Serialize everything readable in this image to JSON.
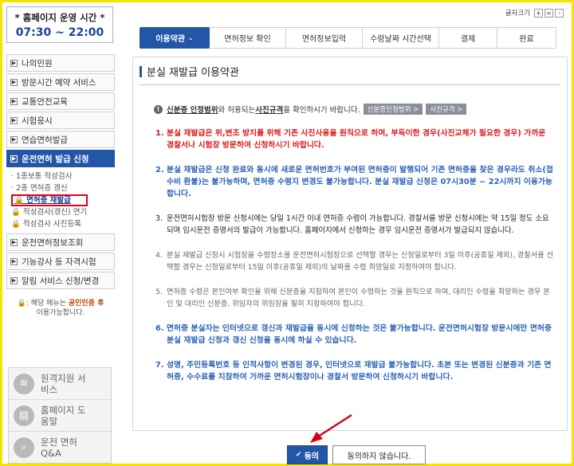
{
  "sidebar": {
    "hours_title": "* 홈페이지 운영 시간 *",
    "hours_time": "07:30 ~ 22:00",
    "menu": [
      {
        "label": "나의민원"
      },
      {
        "label": "방문시간 예약 서비스"
      },
      {
        "label": "교통안전교육"
      },
      {
        "label": "시험응시"
      },
      {
        "label": "연습면허발급"
      },
      {
        "label": "운전면허 발급 신청",
        "active": true
      }
    ],
    "submenu": [
      "1종보통 적성검사",
      "2종 면허증 갱신",
      "면허증 재발급",
      "적성검사(갱신) 연기",
      "적성검사 사진등록"
    ],
    "menu_after": [
      {
        "label": "운전면허정보조회"
      },
      {
        "label": "기능강사 등 자격시험"
      },
      {
        "label": "알림 서비스 신청/변경"
      }
    ],
    "note_prefix": ": 해당 메뉴는 ",
    "note_highlight": "공인인증 후",
    "note_suffix": "이용가능합니다.",
    "services": [
      {
        "icon": "wifi-icon",
        "label": "원격지원 서비스"
      },
      {
        "icon": "help-book-icon",
        "label": "홈페이지 도움말"
      },
      {
        "icon": "search-icon",
        "label": "운전 면허 Q&A"
      }
    ]
  },
  "font_tools": {
    "label": "글자크기",
    "plus": "+",
    "equal": "=",
    "minus": "-"
  },
  "steps": [
    {
      "label": "이용약관",
      "active": true
    },
    {
      "label": "면허정보 확인"
    },
    {
      "label": "면허정보입력"
    },
    {
      "label": "수령날짜 시간선택"
    },
    {
      "label": "결제"
    },
    {
      "label": "완료"
    }
  ],
  "content": {
    "title": "분실 재발급 이용약관",
    "info_prefix": "신분증 인정범위",
    "info_mid1": "와 허용되는 ",
    "info_bold2": "사진규격",
    "info_suffix": "을 확인하시기 바랍니다.",
    "tag1": "신분증인정범위 >",
    "tag2": "사진규격 >",
    "terms": [
      {
        "num": "1.",
        "style": "red",
        "text": "분실 재발급은 위,변조 방지를 위해 기존 사진사용을 원칙으로 하며, 부득이한 경우(사진교체가 필요한 경우) 가까운 경찰서나 시험장 방문하여 신청하시기 바랍니다."
      },
      {
        "num": "2.",
        "style": "blue",
        "text": "분실 재발급은 신청 완료와 동시에 새로운 면허번호가 부여된 면허증이 발행되어 기존 면허증을 찾은 경우라도 취소(접수비 환불)는 불가능하며, 면허증 수령지 변경도 불가능합니다. 분실 재발급 신청은 07시30분 ~ 22시까지 이용가능합니다."
      },
      {
        "num": "3.",
        "style": "dark",
        "text": "운전면허시험장 방문 신청시에는 당일 1시간 이내 면허증 수령이 가능합니다. 경찰서를 방문 신청시에는 약 15일 정도 소요되며 임시운전 증명서의 발급이 가능합니다. 홈페이지에서 신청하는 경우 임시운전 증명서가 발급되지 않습니다."
      },
      {
        "num": "4.",
        "style": "gray",
        "text": "분실 재발급 신청시 시험장을 수령장소를 운전면허시험장으로 선택할 경우는 신청일로부터 3일 이후(공휴일 제외), 경찰서를 선택할 경우는 신청일로부터 15일 이후(공휴일 제외)의 날짜를 수령 희망일로 지정하여야 합니다."
      },
      {
        "num": "5.",
        "style": "gray",
        "text": "면허증 수령은 본인여부 확인을 위해 신분증을 지참하여 본인이 수령하는 것을 원칙으로 하며, 대리인 수령을 희망하는 경우 본인 및 대리인 신분증, 위임자의 위임장을 필히 지참하여야 합니다."
      },
      {
        "num": "6.",
        "style": "blue",
        "text": "면허증 분실자는 인터넷으로 갱신과 재발급을 동시에 신청하는 것은 불가능합니다. 운전면허시험장 방문시에만 면허증 분실 재발급 신청과 갱신 신청을 동시에 하실 수 있습니다."
      },
      {
        "num": "7.",
        "style": "blue",
        "text": "성명, 주민등록번호 등 인적사항이 변경된 경우, 인터넷으로 재발급 불가능합니다. 초본 또는 변경된 신분증과 기존 면허증, 수수료를 지참하여 가까운 면허시험장이나 경찰서 방문하여 신청하시기 바랍니다."
      }
    ]
  },
  "buttons": {
    "agree": "동의",
    "disagree": "동의하지 않습니다."
  },
  "colors": {
    "accent": "#2456a8",
    "highlight_border": "#e0001b",
    "page_border": "#f2e400",
    "arrow": "#d4001a"
  }
}
